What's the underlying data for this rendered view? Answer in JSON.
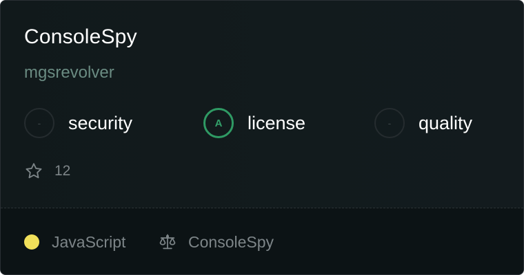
{
  "repo": {
    "name": "ConsoleSpy",
    "owner": "mgsrevolver"
  },
  "grades": [
    {
      "label": "security",
      "grade": "-",
      "status": "none"
    },
    {
      "label": "license",
      "grade": "A",
      "status": "good"
    },
    {
      "label": "quality",
      "grade": "-",
      "status": "none"
    }
  ],
  "stars": {
    "icon": "star-icon",
    "count": "12"
  },
  "footer": {
    "language": "JavaScript",
    "language_color": "#f1e05a",
    "license_icon": "scale-icon",
    "license": "ConsoleSpy"
  },
  "colors": {
    "background": "#11191b",
    "grade_good": "#2f9a64",
    "owner_text": "#6a8b82",
    "muted_text": "#7d8588"
  }
}
